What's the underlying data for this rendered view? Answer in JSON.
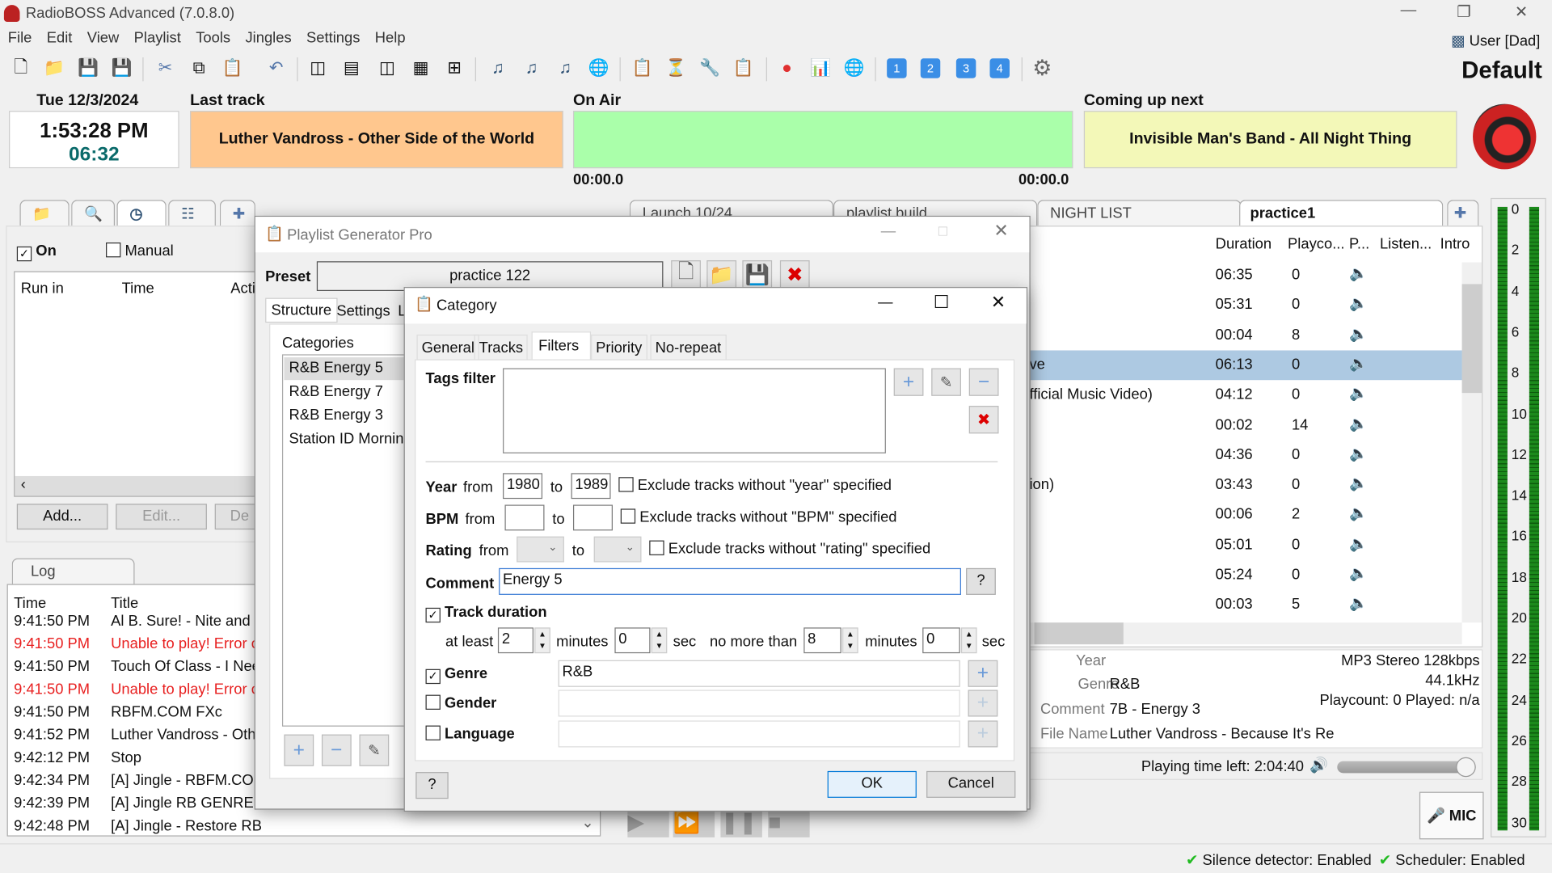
{
  "app": {
    "title": "RadioBOSS Advanced (7.0.8.0)",
    "user": "User [Dad]",
    "profile": "Default"
  },
  "menu": [
    "File",
    "Edit",
    "View",
    "Playlist",
    "Tools",
    "Jingles",
    "Settings",
    "Help"
  ],
  "header": {
    "date": "Tue 12/3/2024",
    "time": "1:53:28 PM",
    "countdown": "06:32",
    "last_track_label": "Last track",
    "last_track": "Luther Vandross - Other Side of the World",
    "on_air_label": "On Air",
    "on_air": "",
    "on_air_elapsed": "00:00.0",
    "on_air_remaining": "00:00.0",
    "next_label": "Coming up next",
    "next": "Invisible Man's Band - All Night Thing",
    "colors": {
      "last": "#ffc78e",
      "onair": "#aaffaa",
      "next": "#f3f8b8"
    }
  },
  "scheduler": {
    "on_label": "On",
    "on_checked": true,
    "manual_label": "Manual",
    "manual_checked": false,
    "columns": [
      "Run in",
      "Time",
      "Acti"
    ],
    "add": "Add...",
    "edit": "Edit...",
    "delete": "De"
  },
  "log": {
    "tab": "Log",
    "columns": [
      "Time",
      "Title"
    ],
    "rows": [
      {
        "time": "9:41:50 PM",
        "title": "Al B. Sure! - Nite and D",
        "error": false
      },
      {
        "time": "9:41:50 PM",
        "title": "Unable to play! Error c",
        "error": true
      },
      {
        "time": "9:41:50 PM",
        "title": "Touch Of Class - I Need",
        "error": false
      },
      {
        "time": "9:41:50 PM",
        "title": "Unable to play! Error c",
        "error": true
      },
      {
        "time": "9:41:50 PM",
        "title": "RBFM.COM FXc",
        "error": false
      },
      {
        "time": "9:41:52 PM",
        "title": "Luther Vandross - Othe",
        "error": false
      },
      {
        "time": "9:42:12 PM",
        "title": "Stop",
        "error": false
      },
      {
        "time": "9:42:34 PM",
        "title": "[A] Jingle - RBFM.COM",
        "error": false
      },
      {
        "time": "9:42:39 PM",
        "title": "[A] Jingle RB GENRES echo",
        "error": false
      },
      {
        "time": "9:42:48 PM",
        "title": "[A] Jingle - Restore RB",
        "error": false
      }
    ]
  },
  "playlist": {
    "tabs": [
      "Launch 10/24",
      "playlist build",
      "NIGHT LIST",
      "practice1"
    ],
    "active_tab": "practice1",
    "columns": [
      "Duration",
      "Playco...",
      "P...",
      "Listen...",
      "Intro"
    ],
    "rows": [
      {
        "title": "",
        "duration": "06:35",
        "playcount": "0"
      },
      {
        "title": "",
        "duration": "05:31",
        "playcount": "0"
      },
      {
        "title": "",
        "duration": "00:04",
        "playcount": "8"
      },
      {
        "title": "ve",
        "duration": "06:13",
        "playcount": "0",
        "selected": true
      },
      {
        "title": "fficial Music Video)",
        "duration": "04:12",
        "playcount": "0"
      },
      {
        "title": "",
        "duration": "00:02",
        "playcount": "14"
      },
      {
        "title": "",
        "duration": "04:36",
        "playcount": "0"
      },
      {
        "title": "ion)",
        "duration": "03:43",
        "playcount": "0"
      },
      {
        "title": "",
        "duration": "00:06",
        "playcount": "2"
      },
      {
        "title": "",
        "duration": "05:01",
        "playcount": "0"
      },
      {
        "title": "",
        "duration": "05:24",
        "playcount": "0"
      },
      {
        "title": "",
        "duration": "00:03",
        "playcount": "5"
      }
    ]
  },
  "trackinfo": {
    "year_label": "Year",
    "year": "",
    "genre_label": "Genre",
    "genre": "R&B",
    "comment_label": "Comment",
    "comment": "7B - Energy 3",
    "filename_label": "File Name",
    "filename": "Luther Vandross - Because It's Re",
    "format": "MP3 Stereo 128kbps",
    "rate": "44.1kHz",
    "playcount": "Playcount: 0  Played: n/a",
    "time_left": "Playing time left: 2:04:40",
    "volume_percent": 100,
    "mic": "MIC"
  },
  "vu": {
    "scale": [
      "0",
      "2",
      "4",
      "6",
      "8",
      "10",
      "12",
      "14",
      "16",
      "18",
      "20",
      "22",
      "24",
      "26",
      "28",
      "30"
    ]
  },
  "status": {
    "silence": "Silence detector: Enabled",
    "scheduler": "Scheduler: Enabled"
  },
  "pgp": {
    "title": "Playlist Generator Pro",
    "preset_label": "Preset",
    "preset": "practice 122",
    "tabs": [
      "Structure",
      "Settings",
      "L"
    ],
    "categories_label": "Categories",
    "categories": [
      "R&B  Energy 5",
      "R&B Energy 7",
      "R&B Energy 3",
      "Station ID Morning"
    ]
  },
  "category": {
    "title": "Category",
    "tabs": [
      "General",
      "Tracks",
      "Filters",
      "Priority",
      "No-repeat"
    ],
    "active_tab": "Filters",
    "tags_label": "Tags filter",
    "year_label": "Year",
    "from": "from",
    "to": "to",
    "year_from": "1980",
    "year_to": "1989",
    "year_excl": "Exclude tracks without \"year\" specified",
    "bpm_label": "BPM",
    "bpm_from": "",
    "bpm_to": "",
    "bpm_excl": "Exclude tracks without \"BPM\" specified",
    "rating_label": "Rating",
    "rating_excl": "Exclude tracks without \"rating\" specified",
    "comment_label": "Comment",
    "comment": "Energy 5",
    "help": "?",
    "duration_label": "Track duration",
    "duration_checked": true,
    "at_least": "at least",
    "min_minutes": "2",
    "minutes": "minutes",
    "min_sec": "0",
    "sec": "sec",
    "no_more": "no more than",
    "max_minutes": "8",
    "max_sec": "0",
    "genre_label": "Genre",
    "genre_checked": true,
    "genre": "R&B",
    "gender_label": "Gender",
    "language_label": "Language",
    "ok": "OK",
    "cancel": "Cancel"
  }
}
